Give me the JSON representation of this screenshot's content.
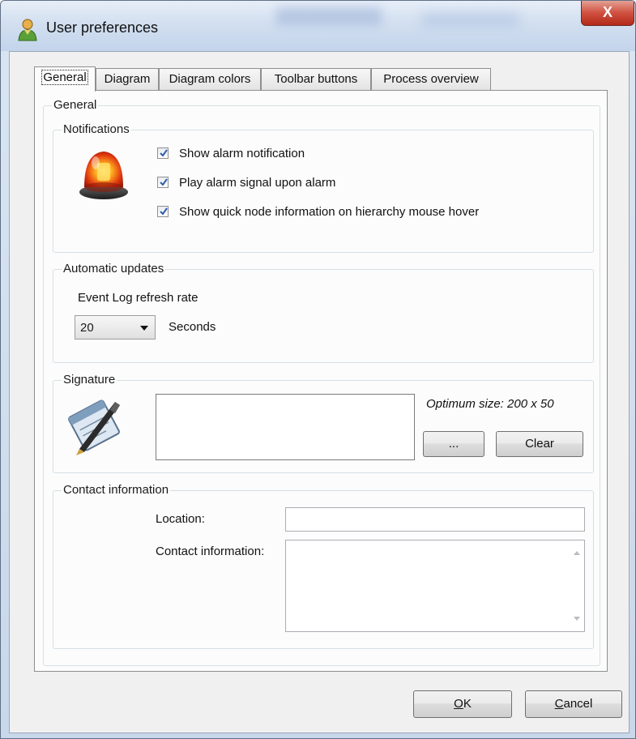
{
  "window": {
    "title": "User preferences",
    "close_glyph": "X"
  },
  "tabs": [
    {
      "label": "General",
      "active": true
    },
    {
      "label": "Diagram",
      "active": false
    },
    {
      "label": "Diagram colors",
      "active": false
    },
    {
      "label": "Toolbar buttons",
      "active": false
    },
    {
      "label": "Process overview",
      "active": false
    }
  ],
  "general_group": {
    "legend": "General"
  },
  "notifications": {
    "legend": "Notifications",
    "icon": "alarm-beacon-icon",
    "options": [
      {
        "label": "Show alarm notification",
        "checked": true
      },
      {
        "label": "Play alarm signal upon alarm",
        "checked": true
      },
      {
        "label": "Show quick node information on hierarchy mouse hover",
        "checked": true
      }
    ]
  },
  "automatic_updates": {
    "legend": "Automatic updates",
    "refresh_label": "Event Log refresh rate",
    "refresh_value": "20",
    "unit": "Seconds"
  },
  "signature": {
    "legend": "Signature",
    "icon": "signature-pen-icon",
    "hint": "Optimum size: 200 x 50",
    "browse_label": "...",
    "clear_label": "Clear"
  },
  "contact": {
    "legend": "Contact information",
    "location_label": "Location:",
    "location_value": "",
    "info_label": "Contact information:",
    "info_value": ""
  },
  "buttons": {
    "ok_accel": "O",
    "ok_rest": "K",
    "cancel_accel": "C",
    "cancel_rest": "ancel"
  },
  "colors": {
    "title_bar": "#d2dff0",
    "close_button": "#c9412f",
    "panel_bg": "#fcfcfc",
    "checkbox_check": "#2f5da8"
  }
}
